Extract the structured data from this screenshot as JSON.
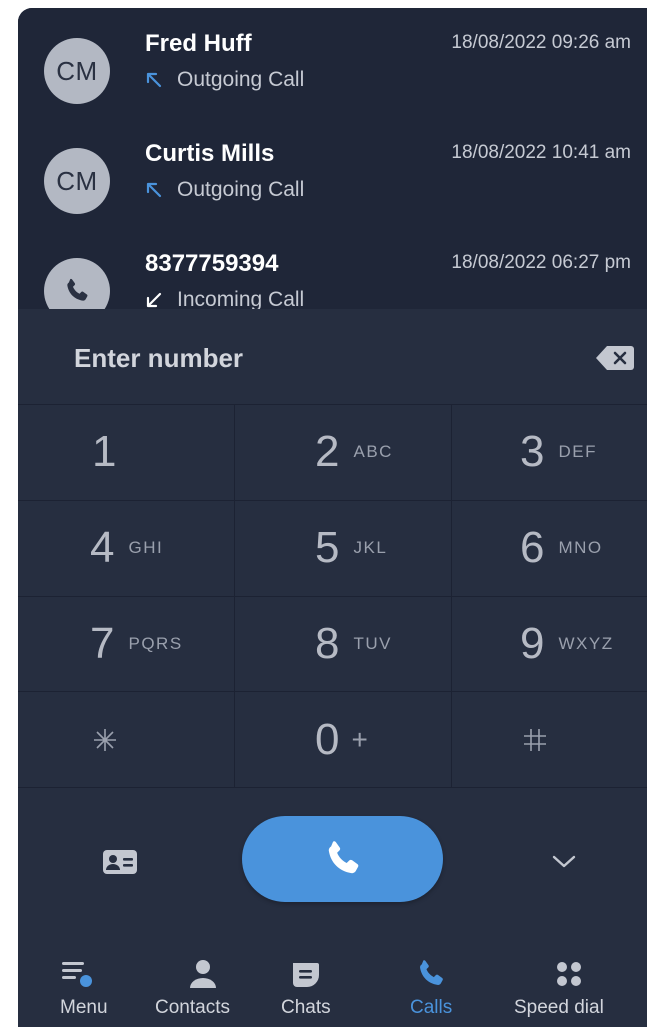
{
  "call_history": [
    {
      "avatar": "CM",
      "avatar_icon": null,
      "name": "Fred Huff",
      "time": "18/08/2022 09:26 am",
      "direction_icon": "outgoing-arrow-icon",
      "type": "Outgoing Call"
    },
    {
      "avatar": "CM",
      "avatar_icon": null,
      "name": "Curtis Mills",
      "time": "18/08/2022 10:41 am",
      "direction_icon": "outgoing-arrow-icon",
      "type": "Outgoing Call"
    },
    {
      "avatar": "",
      "avatar_icon": "phone-icon",
      "name": "8377759394",
      "time": "18/08/2022 06:27 pm",
      "direction_icon": "incoming-arrow-icon",
      "type": "Incoming Call"
    }
  ],
  "dialer": {
    "placeholder": "Enter number",
    "value": "",
    "backspace_icon": "backspace-icon"
  },
  "keypad": [
    {
      "digit": "1",
      "letters": ""
    },
    {
      "digit": "2",
      "letters": "ABC"
    },
    {
      "digit": "3",
      "letters": "DEF"
    },
    {
      "digit": "4",
      "letters": "GHI"
    },
    {
      "digit": "5",
      "letters": "JKL"
    },
    {
      "digit": "6",
      "letters": "MNO"
    },
    {
      "digit": "7",
      "letters": "PQRS"
    },
    {
      "digit": "8",
      "letters": "TUV"
    },
    {
      "digit": "9",
      "letters": "WXYZ"
    },
    {
      "digit": "*",
      "letters": ""
    },
    {
      "digit": "0",
      "letters": "+"
    },
    {
      "digit": "#",
      "letters": ""
    }
  ],
  "actions": {
    "contact_icon": "contact-card-icon",
    "call_icon": "phone-icon",
    "collapse_icon": "chevron-down-icon"
  },
  "nav": [
    {
      "label": "Menu",
      "icon": "menu-icon",
      "active": false
    },
    {
      "label": "Contacts",
      "icon": "contact-person-icon",
      "active": false
    },
    {
      "label": "Chats",
      "icon": "chat-icon",
      "active": false
    },
    {
      "label": "Calls",
      "icon": "phone-icon",
      "active": true
    },
    {
      "label": "Speed dial",
      "icon": "speed-dial-icon",
      "active": false
    }
  ],
  "colors": {
    "background": "#262e40",
    "history_background": "#1f2638",
    "accent": "#4a93dc",
    "avatar": "#b3b8c3",
    "text_primary": "#ffffff",
    "text_secondary": "#c6cad3"
  }
}
